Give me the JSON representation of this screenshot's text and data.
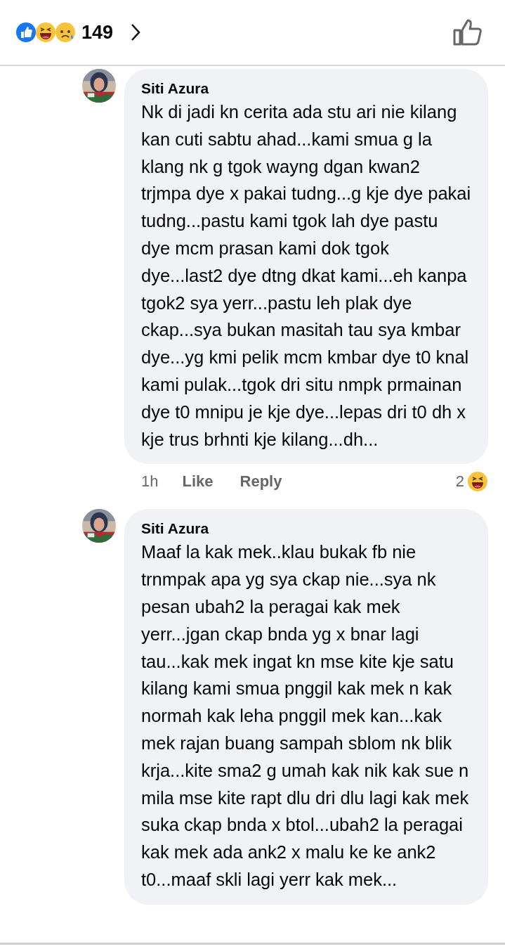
{
  "header": {
    "reaction_count": "149"
  },
  "comments": [
    {
      "author": "Siti Azura",
      "text": "Nk di jadi kn cerita ada stu ari nie kilang kan cuti sabtu ahad...kami smua g la klang nk g tgok wayng dgan kwan2 trjmpa dye x pakai tudng...g kje dye pakai tudng...pastu kami tgok lah dye pastu dye mcm prasan kami dok tgok dye...last2 dye dtng dkat kami...eh kanpa tgok2 sya yerr...pastu leh plak dye ckap...sya bukan masitah tau sya kmbar dye...yg kmi pelik mcm kmbar dye t0 knal kami pulak...tgok dri situ nmpk prmainan dye t0 mnipu je kje dye...lepas dri t0 dh x kje trus brhnti kje kilang...dh...",
      "time": "1h",
      "like": "Like",
      "reply": "Reply",
      "reaction_count": "2"
    },
    {
      "author": "Siti Azura",
      "text": "Maaf la kak mek..klau bukak fb nie trnmpak apa yg sya ckap nie...sya nk pesan ubah2 la peragai kak mek yerr...jgan ckap bnda yg x bnar lagi tau...kak mek ingat kn mse kite kje satu kilang kami smua pnggil kak mek n kak normah kak leha pnggil mek kan...kak mek rajan buang sampah sblom nk blik krja...kite sma2 g umah kak nik kak sue n mila mse kite rapt dlu dri dlu lagi kak mek suka ckap bnda x btol...ubah2 la peragai kak mek ada ank2 x malu ke ke ank2 t0...maaf skli lagi yerr kak mek..."
    }
  ]
}
